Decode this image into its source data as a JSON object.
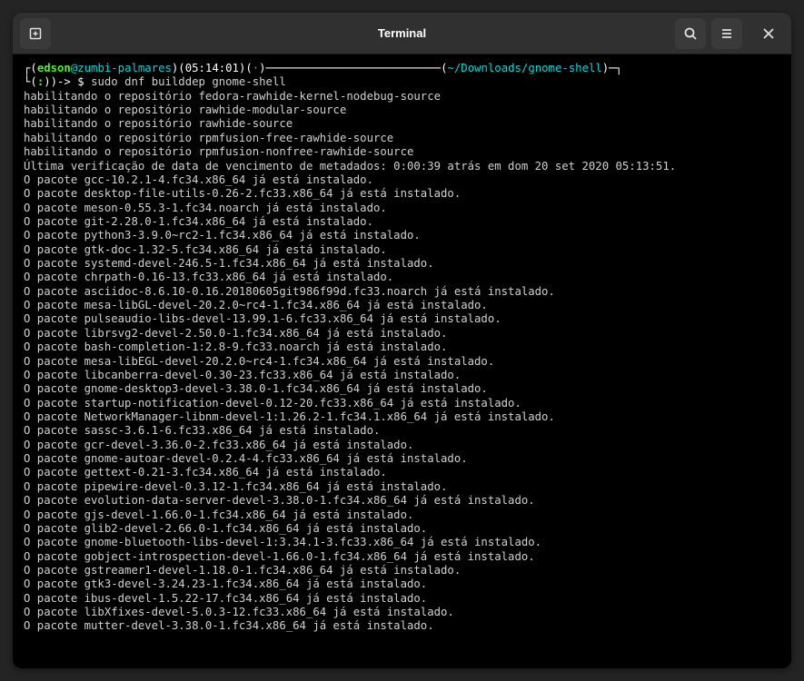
{
  "window": {
    "title": "Terminal"
  },
  "prompt": {
    "user": "edson",
    "at": "@",
    "host": "zumbi-palmares",
    "time_prefix": ")(",
    "time": "05:14:01",
    "time_suffix": ")(",
    "dot": "·",
    "close": ")",
    "dash_line": "──────────────────────────",
    "path_open": "(",
    "path": "~/Downloads/gnome-shell",
    "path_close": ")",
    "prompt2_prefix": "(",
    "prompt2_open": "(",
    "prompt2_colon": ":",
    "prompt2_close": ")",
    "prompt2_suffix": ")",
    "arrow": "-> $ ",
    "command": "sudo dnf builddep gnome-shell"
  },
  "output": [
    "habilitando o repositório fedora-rawhide-kernel-nodebug-source",
    "habilitando o repositório rawhide-modular-source",
    "habilitando o repositório rawhide-source",
    "habilitando o repositório rpmfusion-free-rawhide-source",
    "habilitando o repositório rpmfusion-nonfree-rawhide-source",
    "Última verificação de data de vencimento de metadados: 0:00:39 atrás em dom 20 set 2020 05:13:51.",
    "O pacote gcc-10.2.1-4.fc34.x86_64 já está instalado.",
    "O pacote desktop-file-utils-0.26-2.fc33.x86_64 já está instalado.",
    "O pacote meson-0.55.3-1.fc34.noarch já está instalado.",
    "O pacote git-2.28.0-1.fc34.x86_64 já está instalado.",
    "O pacote python3-3.9.0~rc2-1.fc34.x86_64 já está instalado.",
    "O pacote gtk-doc-1.32-5.fc34.x86_64 já está instalado.",
    "O pacote systemd-devel-246.5-1.fc34.x86_64 já está instalado.",
    "O pacote chrpath-0.16-13.fc33.x86_64 já está instalado.",
    "O pacote asciidoc-8.6.10-0.16.20180605git986f99d.fc33.noarch já está instalado.",
    "O pacote mesa-libGL-devel-20.2.0~rc4-1.fc34.x86_64 já está instalado.",
    "O pacote pulseaudio-libs-devel-13.99.1-6.fc33.x86_64 já está instalado.",
    "O pacote librsvg2-devel-2.50.0-1.fc34.x86_64 já está instalado.",
    "O pacote bash-completion-1:2.8-9.fc33.noarch já está instalado.",
    "O pacote mesa-libEGL-devel-20.2.0~rc4-1.fc34.x86_64 já está instalado.",
    "O pacote libcanberra-devel-0.30-23.fc33.x86_64 já está instalado.",
    "O pacote gnome-desktop3-devel-3.38.0-1.fc34.x86_64 já está instalado.",
    "O pacote startup-notification-devel-0.12-20.fc33.x86_64 já está instalado.",
    "O pacote NetworkManager-libnm-devel-1:1.26.2-1.fc34.1.x86_64 já está instalado.",
    "O pacote sassc-3.6.1-6.fc33.x86_64 já está instalado.",
    "O pacote gcr-devel-3.36.0-2.fc33.x86_64 já está instalado.",
    "O pacote gnome-autoar-devel-0.2.4-4.fc33.x86_64 já está instalado.",
    "O pacote gettext-0.21-3.fc34.x86_64 já está instalado.",
    "O pacote pipewire-devel-0.3.12-1.fc34.x86_64 já está instalado.",
    "O pacote evolution-data-server-devel-3.38.0-1.fc34.x86_64 já está instalado.",
    "O pacote gjs-devel-1.66.0-1.fc34.x86_64 já está instalado.",
    "O pacote glib2-devel-2.66.0-1.fc34.x86_64 já está instalado.",
    "O pacote gnome-bluetooth-libs-devel-1:3.34.1-3.fc33.x86_64 já está instalado.",
    "O pacote gobject-introspection-devel-1.66.0-1.fc34.x86_64 já está instalado.",
    "O pacote gstreamer1-devel-1.18.0-1.fc34.x86_64 já está instalado.",
    "O pacote gtk3-devel-3.24.23-1.fc34.x86_64 já está instalado.",
    "O pacote ibus-devel-1.5.22-17.fc34.x86_64 já está instalado.",
    "O pacote libXfixes-devel-5.0.3-12.fc33.x86_64 já está instalado.",
    "O pacote mutter-devel-3.38.0-1.fc34.x86_64 já está instalado."
  ]
}
